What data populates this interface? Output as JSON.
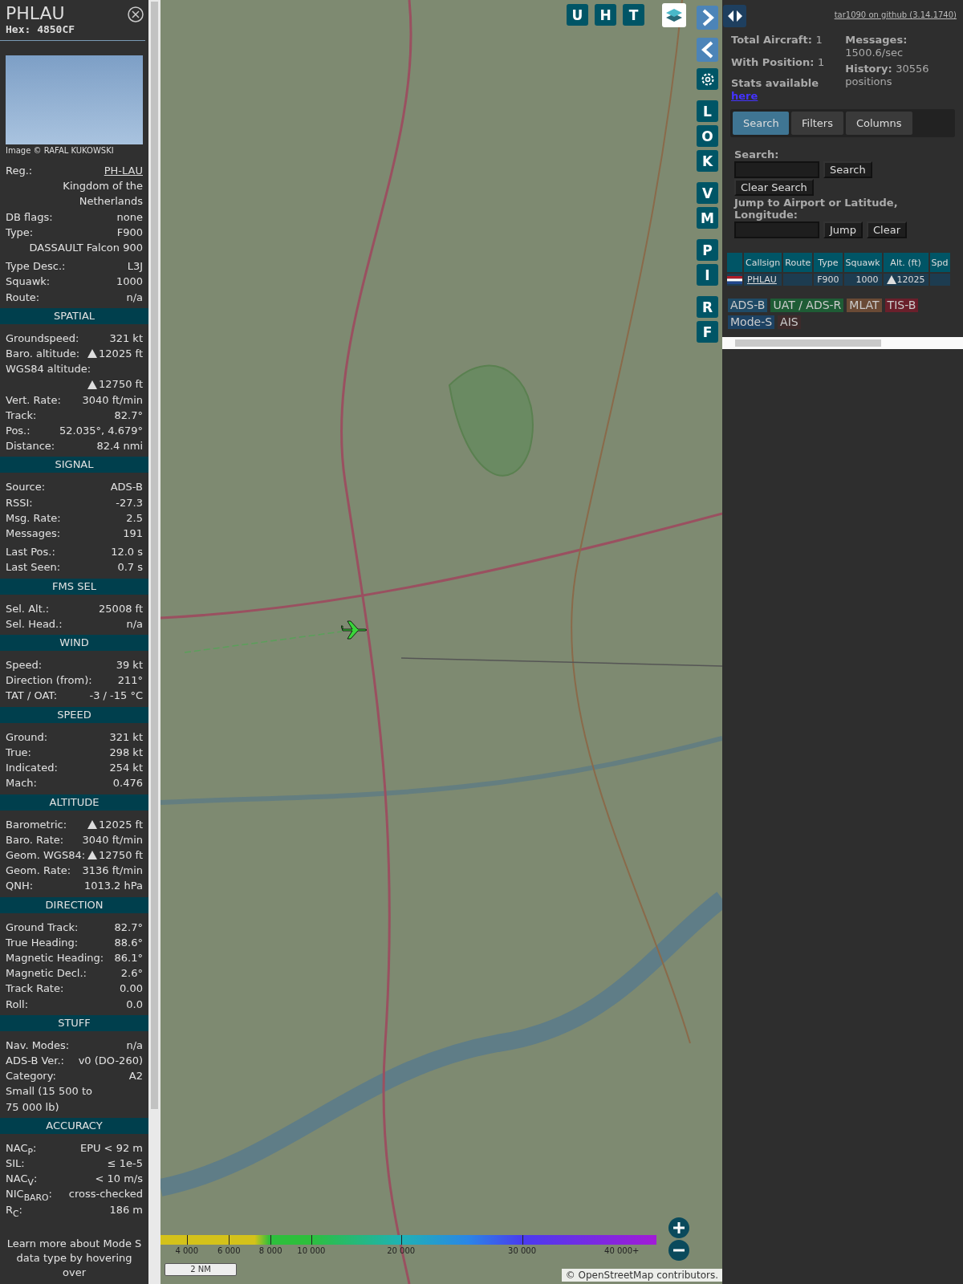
{
  "detail": {
    "title": "PHLAU",
    "hex": "Hex: 4850CF",
    "photo_credit": "Image © RAFAL KUKOWSKI",
    "groups": [
      [
        {
          "kind": "link",
          "label": "Reg.:",
          "value": "PH-LAU"
        },
        {
          "kind": "plain",
          "value": "Kingdom of the Netherlands"
        },
        {
          "kind": "plain",
          "label": "DB flags:",
          "value": "none"
        },
        {
          "kind": "plain",
          "label": "Type:",
          "value": "F900"
        },
        {
          "kind": "plain",
          "value": "DASSAULT Falcon 900"
        }
      ],
      [
        {
          "kind": "plain",
          "label": "Type Desc.:",
          "value": "L3J"
        },
        {
          "kind": "plain",
          "label": "Squawk:",
          "value": "1000"
        },
        {
          "kind": "plain",
          "label": "Route:",
          "value": "n/a"
        }
      ]
    ],
    "sections": [
      {
        "title": "SPATIAL",
        "groups": [
          [
            {
              "kind": "plain",
              "label": "Groundspeed:",
              "value": "321 kt"
            },
            {
              "kind": "climb",
              "label": "Baro. altitude:",
              "value": "12025 ft"
            },
            {
              "kind": "climb",
              "label": "WGS84 altitude:",
              "value": "12750 ft"
            },
            {
              "kind": "plain",
              "label": "Vert. Rate:",
              "value": "3040 ft/min"
            },
            {
              "kind": "plain",
              "label": "Track:",
              "value": "82.7°"
            },
            {
              "kind": "plain",
              "label": "Pos.:",
              "value": "52.035°, 4.679°"
            },
            {
              "kind": "plain",
              "label": "Distance:",
              "value": "82.4 nmi"
            }
          ]
        ]
      },
      {
        "title": "SIGNAL",
        "groups": [
          [
            {
              "kind": "plain",
              "label": "Source:",
              "value": "ADS-B"
            },
            {
              "kind": "plain",
              "label": "RSSI:",
              "value": "-27.3"
            },
            {
              "kind": "plain",
              "label": "Msg. Rate:",
              "value": "2.5"
            },
            {
              "kind": "plain",
              "label": "Messages:",
              "value": "191"
            }
          ],
          [
            {
              "kind": "plain",
              "label": "Last Pos.:",
              "value": "12.0 s"
            },
            {
              "kind": "plain",
              "label": "Last Seen:",
              "value": "0.7 s"
            }
          ]
        ]
      },
      {
        "title": "FMS SEL",
        "groups": [
          [
            {
              "kind": "plain",
              "label": "Sel. Alt.:",
              "value": "25008 ft"
            },
            {
              "kind": "plain",
              "label": "Sel. Head.:",
              "value": "n/a"
            }
          ]
        ]
      },
      {
        "title": "WIND",
        "groups": [
          [
            {
              "kind": "plain",
              "label": "Speed:",
              "value": "39 kt"
            },
            {
              "kind": "plain",
              "label": "Direction (from):",
              "value": "211°"
            },
            {
              "kind": "plain",
              "label": "TAT / OAT:",
              "value": "-3 / -15 °C"
            }
          ]
        ]
      },
      {
        "title": "SPEED",
        "groups": [
          [
            {
              "kind": "plain",
              "label": "Ground:",
              "value": "321 kt"
            },
            {
              "kind": "plain",
              "label": "True:",
              "value": "298 kt"
            },
            {
              "kind": "plain",
              "label": "Indicated:",
              "value": "254 kt"
            },
            {
              "kind": "plain",
              "label": "Mach:",
              "value": "0.476"
            }
          ]
        ]
      },
      {
        "title": "ALTITUDE",
        "groups": [
          [
            {
              "kind": "climb",
              "label": "Barometric:",
              "value": "12025 ft"
            },
            {
              "kind": "plain",
              "label": "Baro. Rate:",
              "value": "3040 ft/min"
            },
            {
              "kind": "climb",
              "label": "Geom. WGS84:",
              "value": "12750 ft"
            },
            {
              "kind": "plain",
              "label": "Geom. Rate:",
              "value": "3136 ft/min"
            },
            {
              "kind": "plain",
              "label": "QNH:",
              "value": "1013.2 hPa"
            }
          ]
        ]
      },
      {
        "title": "DIRECTION",
        "groups": [
          [
            {
              "kind": "plain",
              "label": "Ground Track:",
              "value": "82.7°"
            },
            {
              "kind": "plain",
              "label": "True Heading:",
              "value": "88.6°"
            },
            {
              "kind": "plain",
              "label": "Magnetic Heading:",
              "value": "86.1°"
            },
            {
              "kind": "plain",
              "label": "Magnetic Decl.:",
              "value": "2.6°"
            },
            {
              "kind": "plain",
              "label": "Track Rate:",
              "value": "0.00"
            },
            {
              "kind": "plain",
              "label": "Roll:",
              "value": "0.0"
            }
          ]
        ]
      },
      {
        "title": "STUFF",
        "groups": [
          [
            {
              "kind": "plain",
              "label": "Nav. Modes:",
              "value": "n/a"
            },
            {
              "kind": "plain",
              "label": "ADS-B Ver.:",
              "value": "v0 (DO-260)"
            },
            {
              "kind": "plain",
              "label": "Category:",
              "value": "A2"
            },
            {
              "kind": "note",
              "label": "Small (15 500 to 75 000 lb)"
            }
          ]
        ]
      },
      {
        "title": "ACCURACY",
        "groups": [
          [
            {
              "kind": "plain",
              "label": "NAC$_{P}$:",
              "value": "EPU < 92 m"
            },
            {
              "kind": "plain",
              "label": "SIL:",
              "value": "≤ 1e-5"
            },
            {
              "kind": "plain",
              "label": "NAC$_{V}$:",
              "value": "< 10 m/s"
            },
            {
              "kind": "plain",
              "label": "NIC$_{BARO}$:",
              "value": "cross-checked"
            },
            {
              "kind": "plain",
              "label": "R$_{C}$:",
              "value": "186 m"
            }
          ]
        ]
      }
    ],
    "footer": "Learn more about Mode S data type by hovering over"
  },
  "map": {
    "top_buttons": [
      "U",
      "H",
      "T"
    ],
    "side_buttons": [
      [
        "L",
        "O",
        "K"
      ],
      [
        "V",
        "M"
      ],
      [
        "P",
        "I"
      ],
      [
        "R",
        "F"
      ]
    ],
    "legend": {
      "labels": [
        "4 000",
        "6 000",
        "8 000",
        "10 000",
        "20 000",
        "30 000",
        "40 000+"
      ]
    },
    "scale": "2 NM",
    "attribution": {
      "prefix": "©",
      "link": "OpenStreetMap",
      "suffix": "contributors."
    }
  },
  "panel": {
    "github_link": "tar1090 on github (3.14.1740)",
    "stats": [
      {
        "label": "Total Aircraft:",
        "value": "1"
      },
      {
        "label": "With Position:",
        "value": "1"
      }
    ],
    "stats_right": [
      {
        "label": "Messages:",
        "value": "1500.6/sec"
      },
      {
        "label": "History:",
        "value": "30556 positions"
      }
    ],
    "stats_note": "Stats available",
    "stats_link": "here",
    "tabs": [
      {
        "label": "Search",
        "selected": true
      },
      {
        "label": "Filters",
        "selected": false
      },
      {
        "label": "Columns",
        "selected": false
      }
    ],
    "search_label": "Search:",
    "search_button": "Search",
    "clear_search_button": "Clear Search",
    "jump_label": "Jump to Airport or Latitude, Longitude:",
    "jump_button": "Jump",
    "clear_button": "Clear",
    "table": {
      "columns": [
        "Callsign",
        "Route",
        "Type",
        "Squawk",
        "Alt. (ft)",
        "Spd"
      ],
      "rows": [
        {
          "callsign": "PHLAU",
          "type": "F900",
          "squawk": "1000",
          "altitude": "12025",
          "climbing": true
        }
      ]
    },
    "sources": [
      {
        "label": "ADS-B",
        "color": "#1f4a66"
      },
      {
        "label": "UAT / ADS-R",
        "color": "#1e5c35"
      },
      {
        "label": "MLAT",
        "color": "#6a4a35"
      },
      {
        "label": "TIS-B",
        "color": "#6a1f2b"
      },
      {
        "label": "Mode-S",
        "color": "#1d4263"
      },
      {
        "label": "AIS",
        "color": "#3d2b2b"
      }
    ]
  }
}
